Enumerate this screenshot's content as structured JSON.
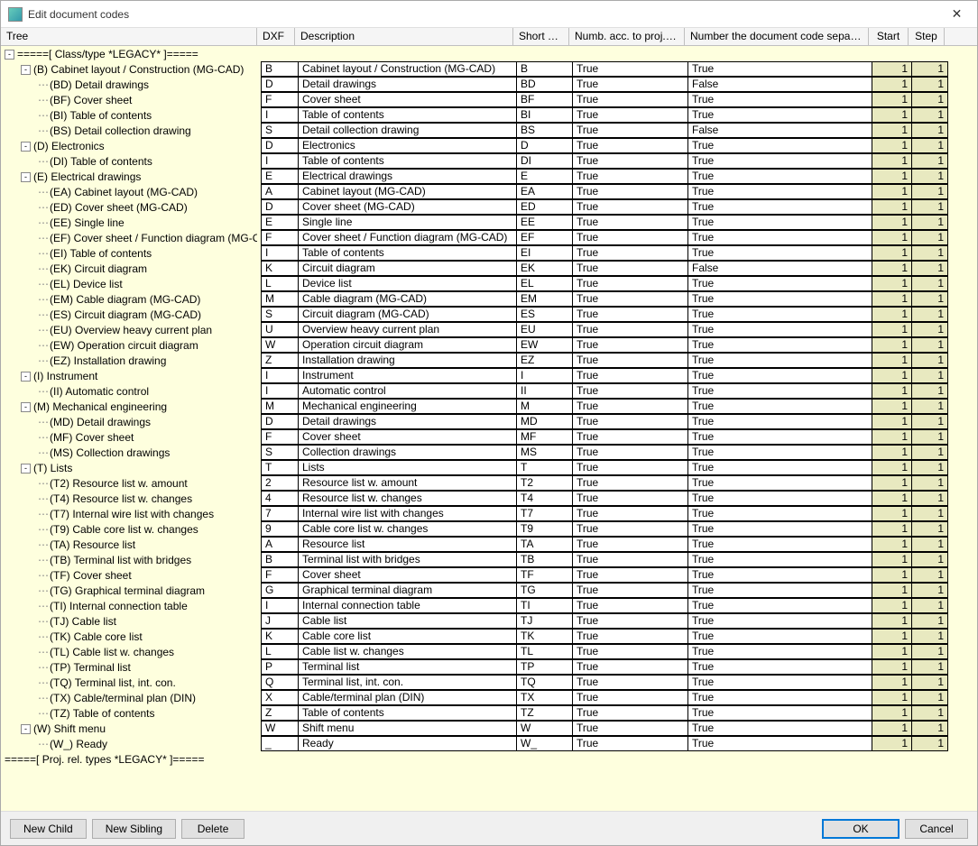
{
  "window": {
    "title": "Edit document codes",
    "close": "✕"
  },
  "headers": {
    "tree": "Tree",
    "dxf": "DXF",
    "desc": "Description",
    "short": "Short Text",
    "proj": "Numb. acc. to proj.par.",
    "sep": "Number the document code separately",
    "start": "Start",
    "step": "Step"
  },
  "tree_header": "=====[ Class/type *LEGACY* ]=====",
  "tree_footer": "=====[ Proj. rel. types *LEGACY* ]=====",
  "items": [
    {
      "depth": 1,
      "exp": "-",
      "label": "(B) Cabinet layout / Construction (MG-CAD)",
      "dxf": "B",
      "desc": "Cabinet layout / Construction (MG-CAD)",
      "short": "B",
      "proj": "True",
      "sep": "True",
      "start": "1",
      "step": "1"
    },
    {
      "depth": 2,
      "label": "(BD) Detail drawings",
      "dxf": "D",
      "desc": "Detail drawings",
      "short": "BD",
      "proj": "True",
      "sep": "False",
      "start": "1",
      "step": "1"
    },
    {
      "depth": 2,
      "label": "(BF) Cover sheet",
      "dxf": "F",
      "desc": "Cover sheet",
      "short": "BF",
      "proj": "True",
      "sep": "True",
      "start": "1",
      "step": "1"
    },
    {
      "depth": 2,
      "label": "(BI) Table of contents",
      "dxf": "I",
      "desc": "Table of contents",
      "short": "BI",
      "proj": "True",
      "sep": "True",
      "start": "1",
      "step": "1"
    },
    {
      "depth": 2,
      "label": "(BS) Detail collection drawing",
      "dxf": "S",
      "desc": "Detail collection drawing",
      "short": "BS",
      "proj": "True",
      "sep": "False",
      "start": "1",
      "step": "1"
    },
    {
      "depth": 1,
      "exp": "-",
      "label": "(D) Electronics",
      "dxf": "D",
      "desc": "Electronics",
      "short": "D",
      "proj": "True",
      "sep": "True",
      "start": "1",
      "step": "1"
    },
    {
      "depth": 2,
      "label": "(DI) Table of contents",
      "dxf": "I",
      "desc": "Table of contents",
      "short": "DI",
      "proj": "True",
      "sep": "True",
      "start": "1",
      "step": "1"
    },
    {
      "depth": 1,
      "exp": "-",
      "label": "(E) Electrical drawings",
      "dxf": "E",
      "desc": "Electrical drawings",
      "short": "E",
      "proj": "True",
      "sep": "True",
      "start": "1",
      "step": "1"
    },
    {
      "depth": 2,
      "label": "(EA) Cabinet layout (MG-CAD)",
      "dxf": "A",
      "desc": "Cabinet layout (MG-CAD)",
      "short": "EA",
      "proj": "True",
      "sep": "True",
      "start": "1",
      "step": "1"
    },
    {
      "depth": 2,
      "label": "(ED) Cover sheet (MG-CAD)",
      "dxf": "D",
      "desc": "Cover sheet (MG-CAD)",
      "short": "ED",
      "proj": "True",
      "sep": "True",
      "start": "1",
      "step": "1"
    },
    {
      "depth": 2,
      "label": "(EE) Single line",
      "dxf": "E",
      "desc": "Single line",
      "short": "EE",
      "proj": "True",
      "sep": "True",
      "start": "1",
      "step": "1"
    },
    {
      "depth": 2,
      "label": "(EF) Cover sheet / Function diagram (MG-CAD)",
      "dxf": "F",
      "desc": "Cover sheet / Function diagram (MG-CAD)",
      "short": "EF",
      "proj": "True",
      "sep": "True",
      "start": "1",
      "step": "1"
    },
    {
      "depth": 2,
      "label": "(EI) Table of contents",
      "dxf": "I",
      "desc": "Table of contents",
      "short": "EI",
      "proj": "True",
      "sep": "True",
      "start": "1",
      "step": "1"
    },
    {
      "depth": 2,
      "label": "(EK) Circuit diagram",
      "dxf": "K",
      "desc": "Circuit diagram",
      "short": "EK",
      "proj": "True",
      "sep": "False",
      "start": "1",
      "step": "1"
    },
    {
      "depth": 2,
      "label": "(EL) Device list",
      "dxf": "L",
      "desc": "Device list",
      "short": "EL",
      "proj": "True",
      "sep": "True",
      "start": "1",
      "step": "1"
    },
    {
      "depth": 2,
      "label": "(EM) Cable diagram (MG-CAD)",
      "dxf": "M",
      "desc": "Cable diagram (MG-CAD)",
      "short": "EM",
      "proj": "True",
      "sep": "True",
      "start": "1",
      "step": "1"
    },
    {
      "depth": 2,
      "label": "(ES) Circuit diagram (MG-CAD)",
      "dxf": "S",
      "desc": "Circuit diagram (MG-CAD)",
      "short": "ES",
      "proj": "True",
      "sep": "True",
      "start": "1",
      "step": "1"
    },
    {
      "depth": 2,
      "label": "(EU) Overview heavy current plan",
      "dxf": "U",
      "desc": "Overview heavy current plan",
      "short": "EU",
      "proj": "True",
      "sep": "True",
      "start": "1",
      "step": "1"
    },
    {
      "depth": 2,
      "label": "(EW) Operation circuit diagram",
      "dxf": "W",
      "desc": "Operation circuit diagram",
      "short": "EW",
      "proj": "True",
      "sep": "True",
      "start": "1",
      "step": "1"
    },
    {
      "depth": 2,
      "label": "(EZ) Installation drawing",
      "dxf": "Z",
      "desc": "Installation drawing",
      "short": "EZ",
      "proj": "True",
      "sep": "True",
      "start": "1",
      "step": "1"
    },
    {
      "depth": 1,
      "exp": "-",
      "label": "(I) Instrument",
      "dxf": "I",
      "desc": "Instrument",
      "short": "I",
      "proj": "True",
      "sep": "True",
      "start": "1",
      "step": "1"
    },
    {
      "depth": 2,
      "label": "(II) Automatic control",
      "dxf": "I",
      "desc": "Automatic control",
      "short": "II",
      "proj": "True",
      "sep": "True",
      "start": "1",
      "step": "1"
    },
    {
      "depth": 1,
      "exp": "-",
      "label": "(M) Mechanical engineering",
      "dxf": "M",
      "desc": "Mechanical engineering",
      "short": "M",
      "proj": "True",
      "sep": "True",
      "start": "1",
      "step": "1"
    },
    {
      "depth": 2,
      "label": "(MD) Detail drawings",
      "dxf": "D",
      "desc": "Detail drawings",
      "short": "MD",
      "proj": "True",
      "sep": "True",
      "start": "1",
      "step": "1"
    },
    {
      "depth": 2,
      "label": "(MF) Cover sheet",
      "dxf": "F",
      "desc": "Cover sheet",
      "short": "MF",
      "proj": "True",
      "sep": "True",
      "start": "1",
      "step": "1"
    },
    {
      "depth": 2,
      "label": "(MS) Collection drawings",
      "dxf": "S",
      "desc": "Collection drawings",
      "short": "MS",
      "proj": "True",
      "sep": "True",
      "start": "1",
      "step": "1"
    },
    {
      "depth": 1,
      "exp": "-",
      "label": "(T) Lists",
      "dxf": "T",
      "desc": "Lists",
      "short": "T",
      "proj": "True",
      "sep": "True",
      "start": "1",
      "step": "1"
    },
    {
      "depth": 2,
      "label": "(T2) Resource list w. amount",
      "dxf": "2",
      "desc": "Resource list w. amount",
      "short": "T2",
      "proj": "True",
      "sep": "True",
      "start": "1",
      "step": "1"
    },
    {
      "depth": 2,
      "label": "(T4) Resource list w. changes",
      "dxf": "4",
      "desc": "Resource list w. changes",
      "short": "T4",
      "proj": "True",
      "sep": "True",
      "start": "1",
      "step": "1"
    },
    {
      "depth": 2,
      "label": "(T7) Internal wire list with changes",
      "dxf": "7",
      "desc": "Internal wire list with changes",
      "short": "T7",
      "proj": "True",
      "sep": "True",
      "start": "1",
      "step": "1"
    },
    {
      "depth": 2,
      "label": "(T9) Cable core list w. changes",
      "dxf": "9",
      "desc": "Cable core list w. changes",
      "short": "T9",
      "proj": "True",
      "sep": "True",
      "start": "1",
      "step": "1"
    },
    {
      "depth": 2,
      "label": "(TA) Resource list",
      "dxf": "A",
      "desc": "Resource list",
      "short": "TA",
      "proj": "True",
      "sep": "True",
      "start": "1",
      "step": "1"
    },
    {
      "depth": 2,
      "label": "(TB) Terminal list with bridges",
      "dxf": "B",
      "desc": "Terminal list with bridges",
      "short": "TB",
      "proj": "True",
      "sep": "True",
      "start": "1",
      "step": "1"
    },
    {
      "depth": 2,
      "label": "(TF) Cover sheet",
      "dxf": "F",
      "desc": "Cover sheet",
      "short": "TF",
      "proj": "True",
      "sep": "True",
      "start": "1",
      "step": "1"
    },
    {
      "depth": 2,
      "label": "(TG) Graphical terminal diagram",
      "dxf": "G",
      "desc": "Graphical terminal diagram",
      "short": "TG",
      "proj": "True",
      "sep": "True",
      "start": "1",
      "step": "1"
    },
    {
      "depth": 2,
      "label": "(TI) Internal connection table",
      "dxf": "I",
      "desc": "Internal connection table",
      "short": "TI",
      "proj": "True",
      "sep": "True",
      "start": "1",
      "step": "1"
    },
    {
      "depth": 2,
      "label": "(TJ) Cable list",
      "dxf": "J",
      "desc": "Cable list",
      "short": "TJ",
      "proj": "True",
      "sep": "True",
      "start": "1",
      "step": "1"
    },
    {
      "depth": 2,
      "label": "(TK) Cable core list",
      "dxf": "K",
      "desc": "Cable core list",
      "short": "TK",
      "proj": "True",
      "sep": "True",
      "start": "1",
      "step": "1"
    },
    {
      "depth": 2,
      "label": "(TL) Cable list w. changes",
      "dxf": "L",
      "desc": "Cable list w. changes",
      "short": "TL",
      "proj": "True",
      "sep": "True",
      "start": "1",
      "step": "1"
    },
    {
      "depth": 2,
      "label": "(TP) Terminal list",
      "dxf": "P",
      "desc": "Terminal list",
      "short": "TP",
      "proj": "True",
      "sep": "True",
      "start": "1",
      "step": "1"
    },
    {
      "depth": 2,
      "label": "(TQ) Terminal list, int. con.",
      "dxf": "Q",
      "desc": "Terminal list, int. con.",
      "short": "TQ",
      "proj": "True",
      "sep": "True",
      "start": "1",
      "step": "1"
    },
    {
      "depth": 2,
      "label": "(TX) Cable/terminal plan (DIN)",
      "dxf": "X",
      "desc": "Cable/terminal plan (DIN)",
      "short": "TX",
      "proj": "True",
      "sep": "True",
      "start": "1",
      "step": "1"
    },
    {
      "depth": 2,
      "label": "(TZ) Table of contents",
      "dxf": "Z",
      "desc": "Table of contents",
      "short": "TZ",
      "proj": "True",
      "sep": "True",
      "start": "1",
      "step": "1"
    },
    {
      "depth": 1,
      "exp": "-",
      "label": "(W) Shift menu",
      "dxf": "W",
      "desc": "Shift menu",
      "short": "W",
      "proj": "True",
      "sep": "True",
      "start": "1",
      "step": "1"
    },
    {
      "depth": 2,
      "label": "(W_) Ready",
      "dxf": "_",
      "desc": "Ready",
      "short": "W_",
      "proj": "True",
      "sep": "True",
      "start": "1",
      "step": "1"
    }
  ],
  "buttons": {
    "new_child": "New Child",
    "new_sibling": "New Sibling",
    "delete": "Delete",
    "ok": "OK",
    "cancel": "Cancel"
  }
}
